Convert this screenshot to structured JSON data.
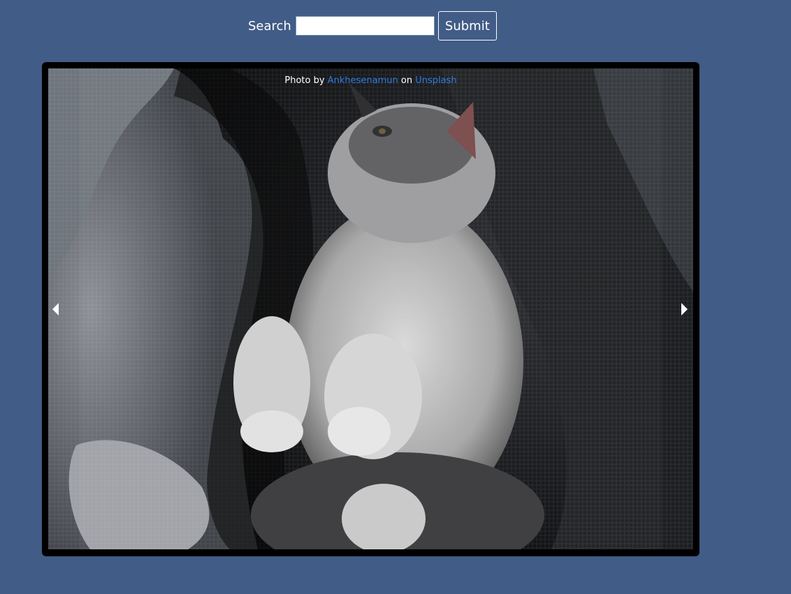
{
  "search": {
    "label": "Search",
    "value": "",
    "placeholder": "",
    "submit_label": "Submit"
  },
  "gallery": {
    "credit": {
      "prefix": "Photo by",
      "author": "Ankhesenamun",
      "on": "on",
      "site": "Unsplash"
    },
    "prev_icon": "chevron-left-icon",
    "next_icon": "chevron-right-icon"
  },
  "colors": {
    "background": "#415c86",
    "link": "#2f7be0",
    "frame": "#000000"
  }
}
